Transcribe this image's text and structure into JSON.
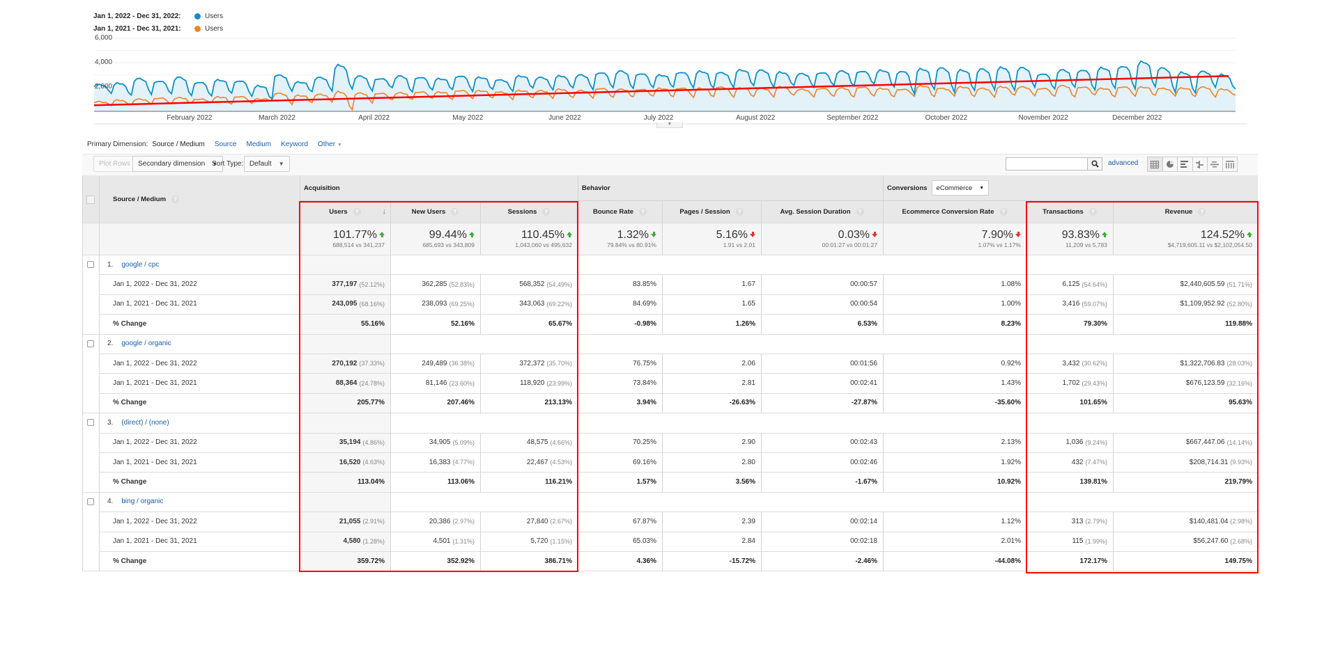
{
  "legend": [
    {
      "range": "Jan 1, 2022 - Dec 31, 2022:",
      "metric": "Users",
      "color": "#0c8fcc"
    },
    {
      "range": "Jan 1, 2021 - Dec 31, 2021:",
      "metric": "Users",
      "color": "#f08423"
    }
  ],
  "chart_data": {
    "type": "line",
    "title": "",
    "xlabel": "",
    "ylabel": "",
    "ylim": [
      0,
      6000
    ],
    "y_ticks": [
      "6,000",
      "4,000",
      "2,000"
    ],
    "x_ticks": [
      "February 2022",
      "March 2022",
      "April 2022",
      "May 2022",
      "June 2022",
      "July 2022",
      "August 2022",
      "September 2022",
      "October 2022",
      "November 2022",
      "December 2022"
    ],
    "grid": true,
    "legend_position": "top-left",
    "series": [
      {
        "name": "Users (Jan 1, 2022 - Dec 31, 2022)",
        "color": "#0c8fcc",
        "fill": "#e3f1f9",
        "weekly_peaks": [
          2200,
          2300,
          2700,
          2500,
          2800,
          2400,
          2600,
          2500,
          2100,
          3000,
          2400,
          2800,
          3800,
          2900,
          2700,
          2900,
          2800,
          2700,
          2900,
          2800,
          2600,
          2900,
          2800,
          2900,
          3000,
          3200,
          3300,
          3100,
          3000,
          3200,
          3300,
          3200,
          3400,
          3400,
          3200,
          3100,
          3200,
          3300,
          3300,
          3400,
          3300,
          3500,
          3600,
          3400,
          3500,
          3600,
          3600,
          3100,
          3400,
          3400,
          3600,
          3700,
          4100,
          3600,
          3200,
          3300,
          3000
        ],
        "weekly_troughs": [
          1500,
          1300,
          1400,
          1400,
          1300,
          1200,
          1500,
          1300,
          1000,
          1700,
          1600,
          1700,
          1800,
          1700,
          1900,
          1600,
          1700,
          1800,
          1700,
          1800,
          1700,
          1900,
          1800,
          1900,
          1800,
          1900,
          1900,
          1900,
          2000,
          2000,
          1900,
          2000,
          2100,
          2000,
          2100,
          2000,
          2100,
          2100,
          2200,
          2000,
          1500,
          1800,
          1600,
          1700,
          1800,
          1700,
          2000,
          1800,
          2000,
          1700,
          1900,
          1900,
          2000,
          1600,
          1500,
          2000,
          1800
        ]
      },
      {
        "name": "Users (Jan 1, 2021 - Dec 31, 2021)",
        "color": "#f08423",
        "weekly_peaks": [
          800,
          900,
          1000,
          1100,
          1100,
          1000,
          1200,
          1200,
          1000,
          1500,
          1300,
          1400,
          1600,
          1500,
          1500,
          1500,
          1600,
          1600,
          1700,
          1700,
          1600,
          1700,
          1700,
          1800,
          1700,
          1900,
          1800,
          1800,
          1900,
          1900,
          1900,
          2000,
          1900,
          1900,
          2000,
          1800,
          1900,
          1900,
          2000,
          1900,
          1800,
          2100,
          1900,
          2000,
          1900,
          2000,
          2000,
          1900,
          2100,
          2000,
          1900,
          2000,
          2000,
          1900,
          1900,
          2000,
          1800
        ],
        "weekly_troughs": [
          500,
          500,
          600,
          600,
          700,
          700,
          600,
          700,
          900,
          600,
          700,
          800,
          100,
          700,
          900,
          1000,
          1000,
          1000,
          1100,
          1100,
          1000,
          1100,
          1100,
          1100,
          1100,
          1100,
          1200,
          1200,
          1200,
          1200,
          1200,
          1200,
          1200,
          1200,
          1300,
          1200,
          1200,
          1200,
          1200,
          1200,
          1300,
          1200,
          1300,
          1200,
          1200,
          1300,
          1300,
          1200,
          1200,
          1300,
          1200,
          1300,
          1300,
          1300,
          1200,
          1200,
          1300
        ]
      },
      {
        "name": "Trend line",
        "color": "#ff0000",
        "start": 500,
        "end": 2900
      }
    ]
  },
  "primary_dimension": {
    "label": "Primary Dimension:",
    "active": "Source / Medium",
    "options": [
      "Source",
      "Medium",
      "Keyword",
      "Other"
    ]
  },
  "toolbar": {
    "plot_rows": "Plot Rows",
    "secondary_dimension": "Secondary dimension",
    "sort_type_label": "Sort Type:",
    "sort_type_value": "Default",
    "search_placeholder": "",
    "advanced": "advanced",
    "views": [
      "table-view-icon",
      "pie-view-icon",
      "bar-view-icon",
      "comparison-view-icon",
      "term-cloud-icon",
      "pivot-view-icon"
    ]
  },
  "table": {
    "dimension_header": "Source / Medium",
    "groups": {
      "acquisition": "Acquisition",
      "behavior": "Behavior",
      "conversions": "Conversions",
      "conversions_select": "eCommerce"
    },
    "columns": [
      "Users",
      "New Users",
      "Sessions",
      "Bounce Rate",
      "Pages / Session",
      "Avg. Session Duration",
      "Ecommerce Conversion Rate",
      "Transactions",
      "Revenue"
    ],
    "summary": [
      {
        "change": "101.77%",
        "dir": "up",
        "good": true,
        "compare": "688,514 vs 341,237"
      },
      {
        "change": "99.44%",
        "dir": "up",
        "good": true,
        "compare": "685,693 vs 343,809"
      },
      {
        "change": "110.45%",
        "dir": "up",
        "good": true,
        "compare": "1,043,060 vs 495,632"
      },
      {
        "change": "1.32%",
        "dir": "down",
        "good": true,
        "compare": "79.84% vs 80.91%"
      },
      {
        "change": "5.16%",
        "dir": "down",
        "good": false,
        "compare": "1.91 vs 2.01"
      },
      {
        "change": "0.03%",
        "dir": "down",
        "good": false,
        "compare": "00:01:27 vs 00:01:27"
      },
      {
        "change": "7.90%",
        "dir": "down",
        "good": false,
        "compare": "1.07% vs 1.17%"
      },
      {
        "change": "93.83%",
        "dir": "up",
        "good": true,
        "compare": "11,209 vs 5,783"
      },
      {
        "change": "124.52%",
        "dir": "up",
        "good": true,
        "compare": "$4,719,605.11 vs $2,102,054.50"
      }
    ],
    "rows": [
      {
        "index": "1.",
        "source": "google / cpc",
        "sub": [
          {
            "label": "Jan 1, 2022 - Dec 31, 2022",
            "values": [
              [
                "377,197",
                "(52.12%)"
              ],
              [
                "362,285",
                "(52.83%)"
              ],
              [
                "568,352",
                "(54.49%)"
              ],
              [
                "83.85%",
                ""
              ],
              [
                "1.67",
                ""
              ],
              [
                "00:00:57",
                ""
              ],
              [
                "1.08%",
                ""
              ],
              [
                "6,125",
                "(54.64%)"
              ],
              [
                "$2,440,605.59",
                "(51.71%)"
              ]
            ]
          },
          {
            "label": "Jan 1, 2021 - Dec 31, 2021",
            "values": [
              [
                "243,095",
                "(68.16%)"
              ],
              [
                "238,093",
                "(69.25%)"
              ],
              [
                "343,063",
                "(69.22%)"
              ],
              [
                "84.69%",
                ""
              ],
              [
                "1.65",
                ""
              ],
              [
                "00:00:54",
                ""
              ],
              [
                "1.00%",
                ""
              ],
              [
                "3,416",
                "(59.07%)"
              ],
              [
                "$1,109,952.92",
                "(52.80%)"
              ]
            ]
          },
          {
            "label": "% Change",
            "values": [
              [
                "55.16%",
                ""
              ],
              [
                "52.16%",
                ""
              ],
              [
                "65.67%",
                ""
              ],
              [
                "-0.98%",
                ""
              ],
              [
                "1.26%",
                ""
              ],
              [
                "6.53%",
                ""
              ],
              [
                "8.23%",
                ""
              ],
              [
                "79.30%",
                ""
              ],
              [
                "119.88%",
                ""
              ]
            ]
          }
        ]
      },
      {
        "index": "2.",
        "source": "google / organic",
        "sub": [
          {
            "label": "Jan 1, 2022 - Dec 31, 2022",
            "values": [
              [
                "270,192",
                "(37.33%)"
              ],
              [
                "249,489",
                "(36.38%)"
              ],
              [
                "372,372",
                "(35.70%)"
              ],
              [
                "76.75%",
                ""
              ],
              [
                "2.06",
                ""
              ],
              [
                "00:01:56",
                ""
              ],
              [
                "0.92%",
                ""
              ],
              [
                "3,432",
                "(30.62%)"
              ],
              [
                "$1,322,706.83",
                "(28.03%)"
              ]
            ]
          },
          {
            "label": "Jan 1, 2021 - Dec 31, 2021",
            "values": [
              [
                "88,364",
                "(24.78%)"
              ],
              [
                "81,146",
                "(23.60%)"
              ],
              [
                "118,920",
                "(23.99%)"
              ],
              [
                "73.84%",
                ""
              ],
              [
                "2.81",
                ""
              ],
              [
                "00:02:41",
                ""
              ],
              [
                "1.43%",
                ""
              ],
              [
                "1,702",
                "(29.43%)"
              ],
              [
                "$676,123.59",
                "(32.16%)"
              ]
            ]
          },
          {
            "label": "% Change",
            "values": [
              [
                "205.77%",
                ""
              ],
              [
                "207.46%",
                ""
              ],
              [
                "213.13%",
                ""
              ],
              [
                "3.94%",
                ""
              ],
              [
                "-26.63%",
                ""
              ],
              [
                "-27.87%",
                ""
              ],
              [
                "-35.60%",
                ""
              ],
              [
                "101.65%",
                ""
              ],
              [
                "95.63%",
                ""
              ]
            ]
          }
        ]
      },
      {
        "index": "3.",
        "source": "(direct) / (none)",
        "sub": [
          {
            "label": "Jan 1, 2022 - Dec 31, 2022",
            "values": [
              [
                "35,194",
                "(4.86%)"
              ],
              [
                "34,905",
                "(5.09%)"
              ],
              [
                "48,575",
                "(4.66%)"
              ],
              [
                "70.25%",
                ""
              ],
              [
                "2.90",
                ""
              ],
              [
                "00:02:43",
                ""
              ],
              [
                "2.13%",
                ""
              ],
              [
                "1,036",
                "(9.24%)"
              ],
              [
                "$667,447.06",
                "(14.14%)"
              ]
            ]
          },
          {
            "label": "Jan 1, 2021 - Dec 31, 2021",
            "values": [
              [
                "16,520",
                "(4.63%)"
              ],
              [
                "16,383",
                "(4.77%)"
              ],
              [
                "22,467",
                "(4.53%)"
              ],
              [
                "69.16%",
                ""
              ],
              [
                "2.80",
                ""
              ],
              [
                "00:02:46",
                ""
              ],
              [
                "1.92%",
                ""
              ],
              [
                "432",
                "(7.47%)"
              ],
              [
                "$208,714.31",
                "(9.93%)"
              ]
            ]
          },
          {
            "label": "% Change",
            "values": [
              [
                "113.04%",
                ""
              ],
              [
                "113.06%",
                ""
              ],
              [
                "116.21%",
                ""
              ],
              [
                "1.57%",
                ""
              ],
              [
                "3.56%",
                ""
              ],
              [
                "-1.67%",
                ""
              ],
              [
                "10.92%",
                ""
              ],
              [
                "139.81%",
                ""
              ],
              [
                "219.79%",
                ""
              ]
            ]
          }
        ]
      },
      {
        "index": "4.",
        "source": "bing / organic",
        "sub": [
          {
            "label": "Jan 1, 2022 - Dec 31, 2022",
            "values": [
              [
                "21,055",
                "(2.91%)"
              ],
              [
                "20,386",
                "(2.97%)"
              ],
              [
                "27,840",
                "(2.67%)"
              ],
              [
                "67.87%",
                ""
              ],
              [
                "2.39",
                ""
              ],
              [
                "00:02:14",
                ""
              ],
              [
                "1.12%",
                ""
              ],
              [
                "313",
                "(2.79%)"
              ],
              [
                "$140,481.04",
                "(2.98%)"
              ]
            ]
          },
          {
            "label": "Jan 1, 2021 - Dec 31, 2021",
            "values": [
              [
                "4,580",
                "(1.28%)"
              ],
              [
                "4,501",
                "(1.31%)"
              ],
              [
                "5,720",
                "(1.15%)"
              ],
              [
                "65.03%",
                ""
              ],
              [
                "2.84",
                ""
              ],
              [
                "00:02:18",
                ""
              ],
              [
                "2.01%",
                ""
              ],
              [
                "115",
                "(1.99%)"
              ],
              [
                "$56,247.60",
                "(2.68%)"
              ]
            ]
          },
          {
            "label": "% Change",
            "values": [
              [
                "359.72%",
                ""
              ],
              [
                "352.92%",
                ""
              ],
              [
                "386.71%",
                ""
              ],
              [
                "4.36%",
                ""
              ],
              [
                "-15.72%",
                ""
              ],
              [
                "-2.46%",
                ""
              ],
              [
                "-44.08%",
                ""
              ],
              [
                "172.17%",
                ""
              ],
              [
                "149.75%",
                ""
              ]
            ]
          }
        ]
      }
    ]
  },
  "highlight_color": "#ff0000"
}
